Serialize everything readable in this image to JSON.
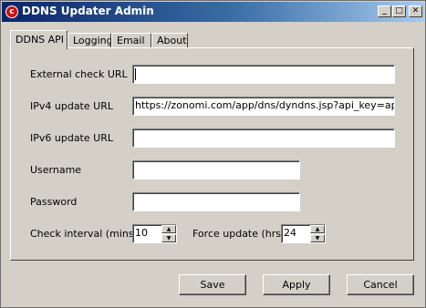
{
  "window": {
    "title": "DDNS Updater Admin"
  },
  "titlebar_buttons": {
    "minimize": "_",
    "maximize": "□",
    "close": "✕"
  },
  "tabs": [
    "DDNS API",
    "Logging",
    "Email",
    "About"
  ],
  "form": {
    "external_check_url": {
      "label": "External check URL",
      "value": ""
    },
    "ipv4_update_url": {
      "label": "IPv4 update URL",
      "value": "https://zonomi.com/app/dns/dyndns.jsp?api_key=apikeyva"
    },
    "ipv6_update_url": {
      "label": "IPv6 update URL",
      "value": ""
    },
    "username": {
      "label": "Username",
      "value": ""
    },
    "password": {
      "label": "Password",
      "value": ""
    },
    "check_interval": {
      "label": "Check interval (mins)",
      "value": "10"
    },
    "force_update": {
      "label": "Force update (hrs)",
      "value": "24"
    }
  },
  "buttons": {
    "save": "Save",
    "apply": "Apply",
    "cancel": "Cancel"
  },
  "colors": {
    "face": "#d4d0c8",
    "title_start": "#0a246a",
    "title_end": "#a6caf0",
    "app_icon": "#cc1111"
  }
}
